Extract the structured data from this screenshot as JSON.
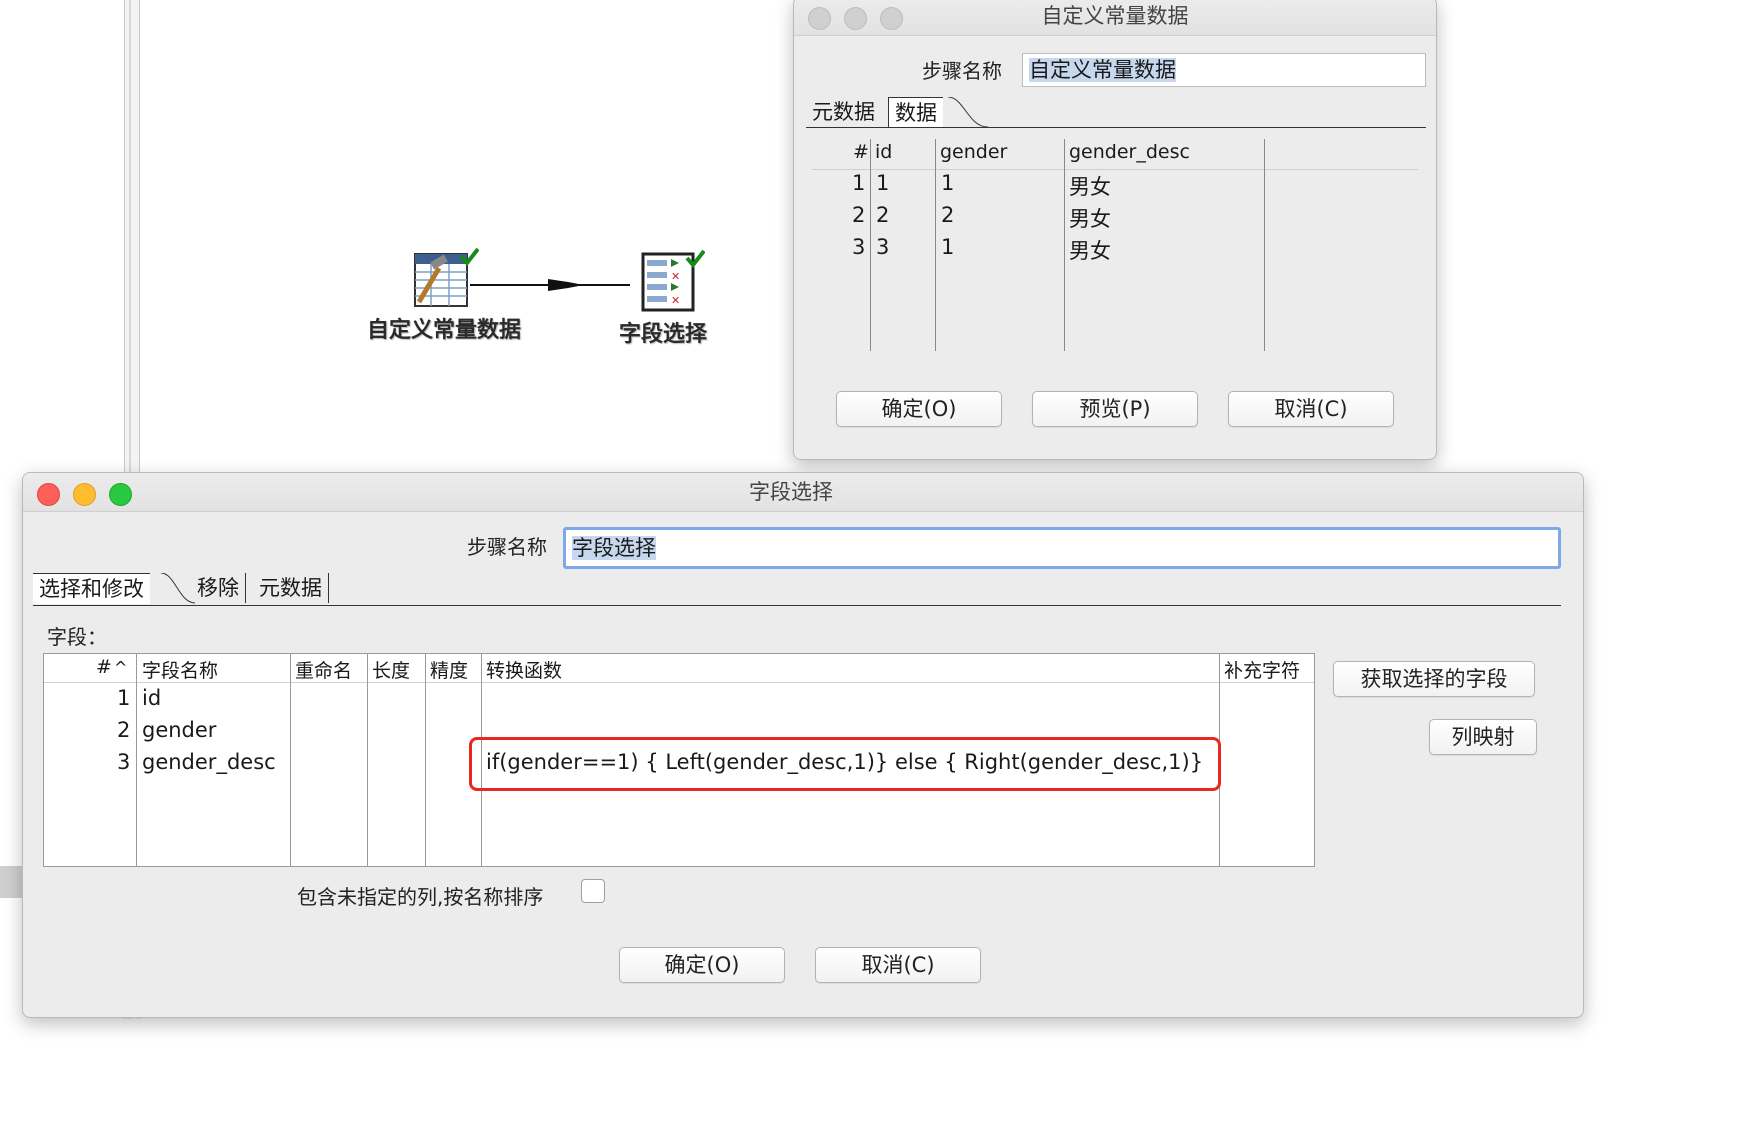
{
  "canvas": {
    "steps": [
      {
        "label": "自定义常量数据",
        "icon": "data-grid-icon"
      },
      {
        "label": "字段选择",
        "icon": "select-values-icon"
      }
    ]
  },
  "const_dialog": {
    "title": "自定义常量数据",
    "step_name_label": "步骤名称",
    "step_name_value": "自定义常量数据",
    "tabs": [
      "元数据",
      "数据"
    ],
    "active_tab": "数据",
    "columns": [
      "#",
      "id",
      "gender",
      "gender_desc"
    ],
    "rows": [
      [
        "1",
        "1",
        "1",
        "男女"
      ],
      [
        "2",
        "2",
        "2",
        "男女"
      ],
      [
        "3",
        "3",
        "1",
        "男女"
      ]
    ],
    "buttons": {
      "ok": "确定(O)",
      "preview": "预览(P)",
      "cancel": "取消(C)"
    }
  },
  "select_dialog": {
    "title": "字段选择",
    "step_name_label": "步骤名称",
    "step_name_value": "字段选择",
    "tabs": [
      "选择和修改",
      "移除",
      "元数据"
    ],
    "active_tab": "选择和修改",
    "fields_label": "字段：",
    "columns": [
      "#",
      "字段名称",
      "重命名",
      "长度",
      "精度",
      "转换函数",
      "补充字符"
    ],
    "sort_indicator": "^",
    "rows": [
      {
        "num": "1",
        "name": "id",
        "func": ""
      },
      {
        "num": "2",
        "name": "gender",
        "func": ""
      },
      {
        "num": "3",
        "name": "gender_desc",
        "func": "if(gender==1)  { Left(gender_desc,1)} else { Right(gender_desc,1)}"
      }
    ],
    "side_buttons": {
      "get_fields": "获取选择的字段",
      "col_mapping": "列映射"
    },
    "include_unspecified_label": "包含未指定的列,按名称排序",
    "include_unspecified_checked": false,
    "buttons": {
      "ok": "确定(O)",
      "cancel": "取消(C)"
    },
    "highlight_color": "#e8281e"
  }
}
